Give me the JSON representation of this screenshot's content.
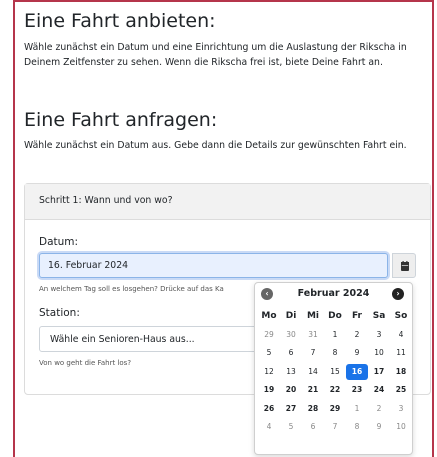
{
  "offer": {
    "title": "Eine Fahrt anbieten:",
    "text": "Wähle zunächst ein Datum und eine Einrichtung um die Auslastung der Rikscha in Deinem Zeitfenster zu sehen. Wenn die Rikscha frei ist, biete Deine Fahrt an."
  },
  "request": {
    "title": "Eine Fahrt anfragen:",
    "text": "Wähle zunächst ein Datum aus. Gebe dann die Details zur gewünschten Fahrt ein."
  },
  "card": {
    "header": "Schritt 1: Wann und von wo?",
    "date_label": "Datum:",
    "date_value": "16. Februar 2024",
    "date_help": "An welchem Tag soll es losgehen? Drücke auf das Ka",
    "station_label": "Station:",
    "station_value": "Wähle ein Senioren-Haus aus...",
    "station_help": "Von wo geht die Fahrt los?"
  },
  "icons": {
    "calendar": "calendar-icon",
    "prev": "chevron-left-icon",
    "next": "chevron-right-icon"
  },
  "datepicker": {
    "title": "Februar 2024",
    "prev": "‹",
    "next": "›",
    "weekdays": [
      "Mo",
      "Di",
      "Mi",
      "Do",
      "Fr",
      "Sa",
      "So"
    ],
    "weeks": [
      [
        {
          "d": "29",
          "m": true
        },
        {
          "d": "30",
          "m": true
        },
        {
          "d": "31",
          "m": true
        },
        {
          "d": "1"
        },
        {
          "d": "2"
        },
        {
          "d": "3"
        },
        {
          "d": "4"
        }
      ],
      [
        {
          "d": "5"
        },
        {
          "d": "6"
        },
        {
          "d": "7"
        },
        {
          "d": "8"
        },
        {
          "d": "9"
        },
        {
          "d": "10"
        },
        {
          "d": "11"
        }
      ],
      [
        {
          "d": "12"
        },
        {
          "d": "13"
        },
        {
          "d": "14"
        },
        {
          "d": "15"
        },
        {
          "d": "16",
          "a": true
        },
        {
          "d": "17",
          "b": true
        },
        {
          "d": "18",
          "b": true
        }
      ],
      [
        {
          "d": "19",
          "b": true
        },
        {
          "d": "20",
          "b": true
        },
        {
          "d": "21",
          "b": true
        },
        {
          "d": "22",
          "b": true
        },
        {
          "d": "23",
          "b": true
        },
        {
          "d": "24",
          "b": true
        },
        {
          "d": "25",
          "b": true
        }
      ],
      [
        {
          "d": "26",
          "b": true
        },
        {
          "d": "27",
          "b": true
        },
        {
          "d": "28",
          "b": true
        },
        {
          "d": "29",
          "b": true
        },
        {
          "d": "1",
          "m": true
        },
        {
          "d": "2",
          "m": true
        },
        {
          "d": "3",
          "m": true
        }
      ],
      [
        {
          "d": "4",
          "m": true
        },
        {
          "d": "5",
          "m": true
        },
        {
          "d": "6",
          "m": true
        },
        {
          "d": "7",
          "m": true
        },
        {
          "d": "8",
          "m": true
        },
        {
          "d": "9",
          "m": true
        },
        {
          "d": "10",
          "m": true
        }
      ]
    ],
    "active_color": "#1a73e8"
  }
}
